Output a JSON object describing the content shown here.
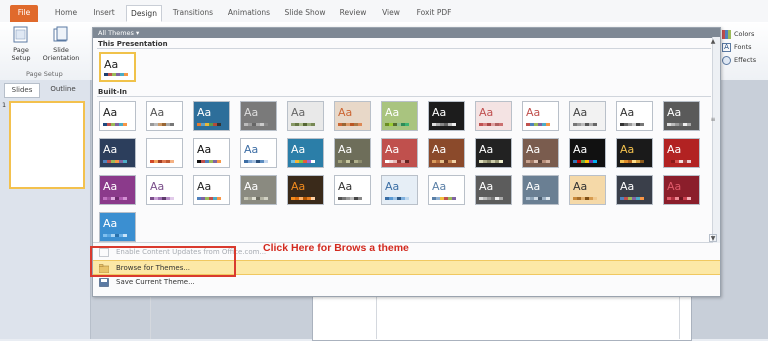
{
  "ribbon": {
    "tabs": [
      "File",
      "Home",
      "Insert",
      "Design",
      "Transitions",
      "Animations",
      "Slide Show",
      "Review",
      "View",
      "Foxit PDF"
    ],
    "active_tab": "Design",
    "page_setup_label": "Page Setup",
    "slide_orientation_label": "Slide Orientation",
    "group_label": "Page Setup",
    "colors_label": "Colors",
    "fonts_label": "Fonts",
    "effects_label": "Effects"
  },
  "left_pane": {
    "tabs": [
      "Slides",
      "Outline"
    ],
    "slide_number": "1"
  },
  "theme_gallery": {
    "header": "All Themes",
    "this_presentation_label": "This Presentation",
    "builtin_label": "Built-In",
    "this_presentation_theme": {
      "text": "Aa",
      "bg": "#ffffff",
      "fg": "#222222",
      "swatch": [
        "#1f3f6f",
        "#c0504d",
        "#9bbb59",
        "#8064a2",
        "#4bacc6",
        "#f79646"
      ]
    },
    "rows": [
      [
        {
          "text": "Aa",
          "bg": "#ffffff",
          "fg": "#222222",
          "swatch": [
            "#1f497d",
            "#c0504d",
            "#9bbb59",
            "#8064a2",
            "#4bacc6",
            "#f79646"
          ]
        },
        {
          "text": "Aa",
          "bg": "#ffffff",
          "fg": "#555555",
          "swatch": [
            "#999999",
            "#bbbbbb",
            "#cc9966",
            "#996633",
            "#aaaaaa",
            "#777777"
          ]
        },
        {
          "text": "Aa",
          "bg": "#2d6e9a",
          "fg": "#ffffff",
          "swatch": [
            "#e47a2e",
            "#5fa0c9",
            "#e7b83b",
            "#5a9b50",
            "#b24a3b",
            "#333333"
          ]
        },
        {
          "text": "Aa",
          "bg": "#7a7a7a",
          "fg": "#dddddd",
          "swatch": [
            "#bbbbbb",
            "#999999",
            "#666666",
            "#aaaaaa",
            "#cccccc",
            "#888888"
          ]
        },
        {
          "text": "Aa",
          "bg": "#e9e9e9",
          "fg": "#666666",
          "swatch": [
            "#889966",
            "#667744",
            "#aabb88",
            "#556633",
            "#99aa77",
            "#778855"
          ]
        },
        {
          "text": "Aa",
          "bg": "#e8d8c8",
          "fg": "#cc6633",
          "swatch": [
            "#cc6633",
            "#996633",
            "#dd9966",
            "#bb5522",
            "#aa7744",
            "#dd8855"
          ]
        },
        {
          "text": "Aa",
          "bg": "#a9c47f",
          "fg": "#ffffff",
          "swatch": [
            "#6b8e23",
            "#9acd32",
            "#556b2f",
            "#8fbc8f",
            "#2e8b57",
            "#3cb371"
          ]
        },
        {
          "text": "Aa",
          "bg": "#1c1c1c",
          "fg": "#ffffff",
          "swatch": [
            "#dddddd",
            "#aaaaaa",
            "#888888",
            "#666666",
            "#bbbbbb",
            "#eeeeee"
          ]
        },
        {
          "text": "Aa",
          "bg": "#f4e3e3",
          "fg": "#c05050",
          "swatch": [
            "#c05050",
            "#d88080",
            "#aa4444",
            "#e0a0a0",
            "#b06060",
            "#cc7070"
          ]
        },
        {
          "text": "Aa",
          "bg": "#ffffff",
          "fg": "#c0504d",
          "swatch": [
            "#c0504d",
            "#4f81bd",
            "#9bbb59",
            "#8064a2",
            "#4bacc6",
            "#f79646"
          ]
        },
        {
          "text": "Aa",
          "bg": "#f2f2f2",
          "fg": "#444444",
          "swatch": [
            "#777777",
            "#999999",
            "#bbbbbb",
            "#555555",
            "#aaaaaa",
            "#666666"
          ]
        },
        {
          "text": "Aa",
          "bg": "#ffffff",
          "fg": "#333333",
          "swatch": [
            "#333333",
            "#666666",
            "#999999",
            "#cccccc",
            "#444444",
            "#777777"
          ]
        },
        {
          "text": "Aa",
          "bg": "#5a5a5a",
          "fg": "#ffffff",
          "swatch": [
            "#dddddd",
            "#bbbbbb",
            "#999999",
            "#777777",
            "#eeeeee",
            "#aaaaaa"
          ]
        }
      ],
      [
        {
          "text": "Aa",
          "bg": "#2c3e5c",
          "fg": "#ffffff",
          "swatch": [
            "#4f81bd",
            "#c0504d",
            "#9bbb59",
            "#f79646",
            "#8064a2",
            "#4bacc6"
          ]
        },
        {
          "text": "Aa",
          "bg": "#ffffff",
          "fg": "#ffffff",
          "swatch": [
            "#d24726",
            "#f2a35e",
            "#a33d22",
            "#e07b54",
            "#bf5a33",
            "#f4b183"
          ]
        },
        {
          "text": "Aa",
          "bg": "#ffffff",
          "fg": "#111111",
          "swatch": [
            "#111111",
            "#c0504d",
            "#4f81bd",
            "#9bbb59",
            "#8064a2",
            "#f79646"
          ]
        },
        {
          "text": "Aa",
          "bg": "#ffffff",
          "fg": "#3d6ea5",
          "swatch": [
            "#3d6ea5",
            "#7fa7d4",
            "#a5c0e0",
            "#2a4f7a",
            "#5b8cc0",
            "#c8d9ef"
          ]
        },
        {
          "text": "Aa",
          "bg": "#2b7ea8",
          "fg": "#ffffff",
          "swatch": [
            "#6cc0e5",
            "#f5b335",
            "#83c441",
            "#e65c3b",
            "#9d6ad1",
            "#ffffff"
          ]
        },
        {
          "text": "Aa",
          "bg": "#6e6e5a",
          "fg": "#ffffff",
          "swatch": [
            "#a2a27c",
            "#7a7a5c",
            "#c8c8a0",
            "#595943",
            "#b0b08c",
            "#8d8d6e"
          ]
        },
        {
          "text": "Aa",
          "bg": "#c0504d",
          "fg": "#ffffff",
          "swatch": [
            "#ffffff",
            "#f2dcdb",
            "#e6b9b8",
            "#953735",
            "#d99594",
            "#632523"
          ]
        },
        {
          "text": "Aa",
          "bg": "#8b4a2b",
          "fg": "#ffffff",
          "swatch": [
            "#d99b5c",
            "#b36b3a",
            "#e5c08a",
            "#6e3a20",
            "#c4844f",
            "#f0d2a6"
          ]
        },
        {
          "text": "Aa",
          "bg": "#222222",
          "fg": "#ffffff",
          "swatch": [
            "#ddddbb",
            "#aaaa88",
            "#888866",
            "#ccccaa",
            "#999977",
            "#eeeecc"
          ]
        },
        {
          "text": "Aa",
          "bg": "#7a5c4e",
          "fg": "#ffffff",
          "swatch": [
            "#c9a38f",
            "#a57c67",
            "#e0c4b5",
            "#5a4136",
            "#b88f7b",
            "#d6b4a2"
          ]
        },
        {
          "text": "Aa",
          "bg": "#111111",
          "fg": "#ffffff",
          "swatch": [
            "#2e75b6",
            "#c00000",
            "#70ad47",
            "#ffc000",
            "#7030a0",
            "#00b0f0"
          ]
        },
        {
          "text": "Aa",
          "bg": "#1a1a1a",
          "fg": "#f2c14e",
          "swatch": [
            "#f2c14e",
            "#e08e2b",
            "#b5651d",
            "#ffde8a",
            "#d9a441",
            "#8c5a1a"
          ]
        },
        {
          "text": "Aa",
          "bg": "#b22222",
          "fg": "#ffffff",
          "swatch": [
            "#b22222",
            "#8b1a1a",
            "#d9534f",
            "#f2dede",
            "#a94442",
            "#ebccd1"
          ]
        }
      ],
      [
        {
          "text": "Aa",
          "bg": "#8b3a8b",
          "fg": "#ffffff",
          "swatch": [
            "#c071c0",
            "#9f4f9f",
            "#e0a8e0",
            "#6e2a6e",
            "#b35cb3",
            "#d490d4"
          ]
        },
        {
          "text": "Aa",
          "bg": "#ffffff",
          "fg": "#7a4e8a",
          "swatch": [
            "#7a4e8a",
            "#c9a0d6",
            "#9f6fb3",
            "#5d3a6b",
            "#b78dc7",
            "#e2cbea"
          ]
        },
        {
          "text": "Aa",
          "bg": "#ffffff",
          "fg": "#222222",
          "swatch": [
            "#4f81bd",
            "#8064a2",
            "#9bbb59",
            "#c0504d",
            "#4bacc6",
            "#f79646"
          ]
        },
        {
          "text": "Aa",
          "bg": "#8a8a80",
          "fg": "#ffffff",
          "swatch": [
            "#c4c4b4",
            "#a6a696",
            "#e0e0d2",
            "#6e6e62",
            "#b4b4a4",
            "#d2d2c4"
          ]
        },
        {
          "text": "Aa",
          "bg": "#3a2a1a",
          "fg": "#f28b1e",
          "swatch": [
            "#f28b1e",
            "#d96b0b",
            "#ffb066",
            "#b35500",
            "#e67e22",
            "#ffd1a3"
          ]
        },
        {
          "text": "Aa",
          "bg": "#ffffff",
          "fg": "#333333",
          "swatch": [
            "#555555",
            "#777777",
            "#999999",
            "#bbbbbb",
            "#444444",
            "#888888"
          ]
        },
        {
          "text": "Aa",
          "bg": "#e6eef6",
          "fg": "#3a6ea5",
          "swatch": [
            "#3a6ea5",
            "#5b9bd5",
            "#9dc3e6",
            "#2e5a87",
            "#7fb0de",
            "#bdd7ee"
          ]
        },
        {
          "text": "Aa",
          "bg": "#ffffff",
          "fg": "#5a7fa6",
          "swatch": [
            "#5a7fa6",
            "#8fb0d1",
            "#f0c040",
            "#c0504d",
            "#9bbb59",
            "#8064a2"
          ]
        },
        {
          "text": "Aa",
          "bg": "#5c5c5c",
          "fg": "#ffffff",
          "swatch": [
            "#dddddd",
            "#bbbbbb",
            "#999999",
            "#777777",
            "#eeeeee",
            "#aaaaaa"
          ]
        },
        {
          "text": "Aa",
          "bg": "#6a7f93",
          "fg": "#ffffff",
          "swatch": [
            "#aebfd0",
            "#8ea4b8",
            "#cedae5",
            "#4f6275",
            "#9eb2c5",
            "#dde6ee"
          ]
        },
        {
          "text": "Aa",
          "bg": "#f5d9a8",
          "fg": "#333333",
          "swatch": [
            "#c98a3a",
            "#a86f2a",
            "#e2b06b",
            "#7e4f15",
            "#d79c50",
            "#f0c98f"
          ]
        },
        {
          "text": "Aa",
          "bg": "#3a3f4a",
          "fg": "#ffffff",
          "swatch": [
            "#4f81bd",
            "#c0504d",
            "#9bbb59",
            "#8064a2",
            "#4bacc6",
            "#f79646"
          ]
        },
        {
          "text": "Aa",
          "bg": "#8b1e2b",
          "fg": "#e05a6a",
          "swatch": [
            "#e05a6a",
            "#b23040",
            "#f08a96",
            "#6e1520",
            "#c9404f",
            "#f5b0b8"
          ]
        }
      ],
      [
        {
          "text": "Aa",
          "bg": "#3b8fd1",
          "fg": "#ffffff",
          "swatch": [
            "#7fbfee",
            "#5aa8e3",
            "#a6d3f4",
            "#2b73ad",
            "#6db3ea",
            "#c8e3f8"
          ]
        }
      ]
    ]
  },
  "menu": {
    "enable_updates": "Enable Content Updates from Office.com...",
    "browse": "Browse for Themes...",
    "save": "Save Current Theme..."
  },
  "annotation": "Click Here for Brows a theme",
  "colors": {
    "highlight": "#fce8a6",
    "redbox": "#d93a2e",
    "annotation": "#d32a1f"
  }
}
